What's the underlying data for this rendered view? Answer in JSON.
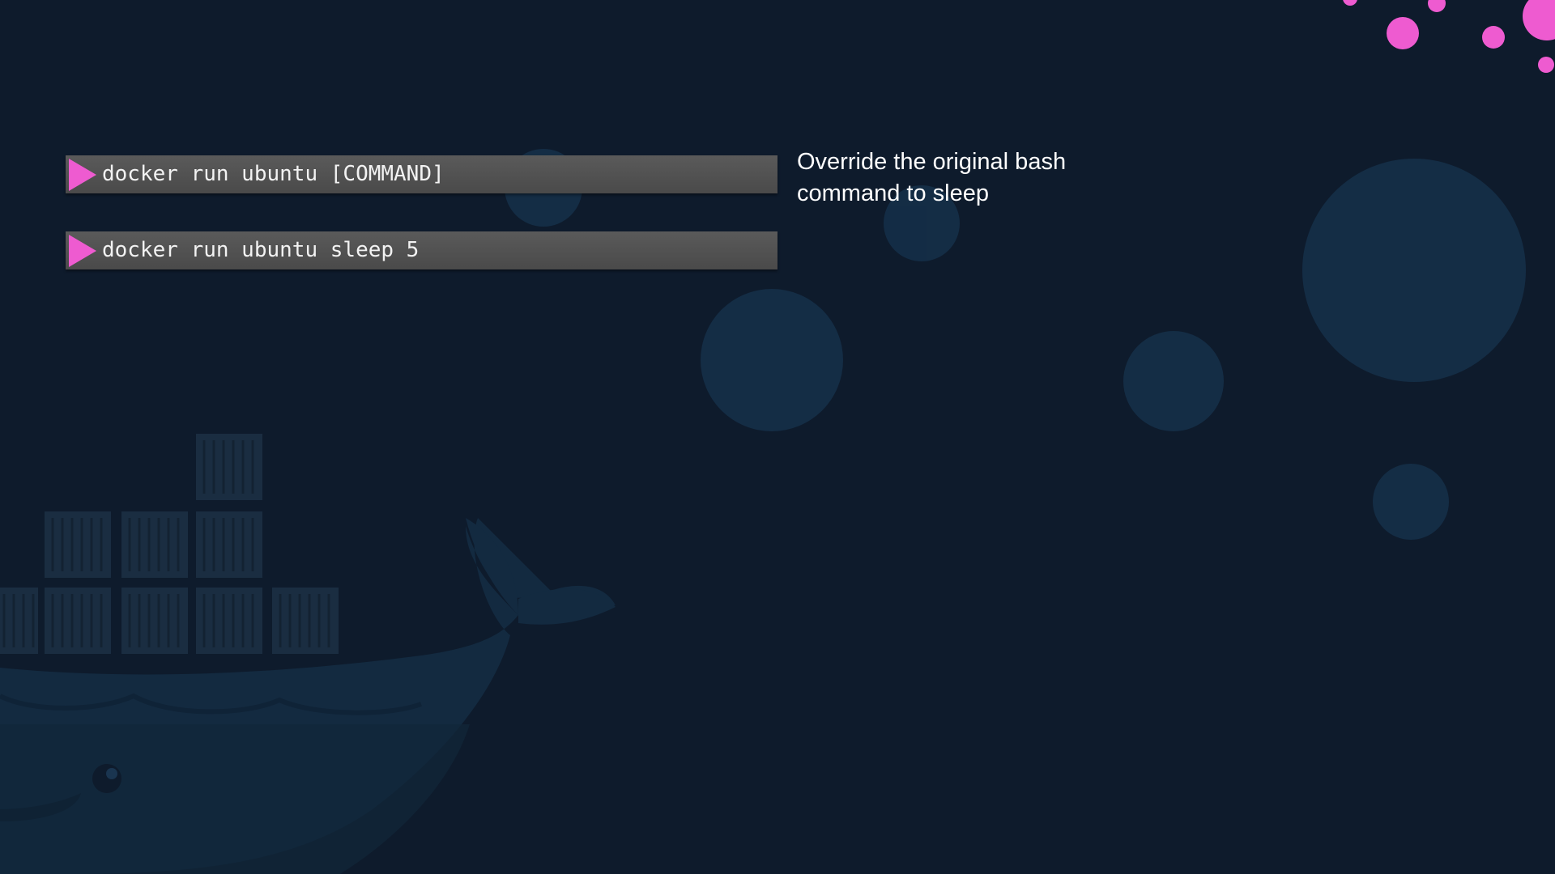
{
  "commands": [
    {
      "text": "docker run ubuntu [COMMAND]",
      "icon": "play-triangle-icon"
    },
    {
      "text": "docker run ubuntu sleep 5",
      "icon": "play-triangle-icon"
    }
  ],
  "note": {
    "line1": "Override the original bash",
    "line2": "command to sleep"
  },
  "colors": {
    "background": "#0e1b2c",
    "accent_pink": "#ee5bd0",
    "command_bar": "#505050",
    "bubble": "#15304a"
  }
}
